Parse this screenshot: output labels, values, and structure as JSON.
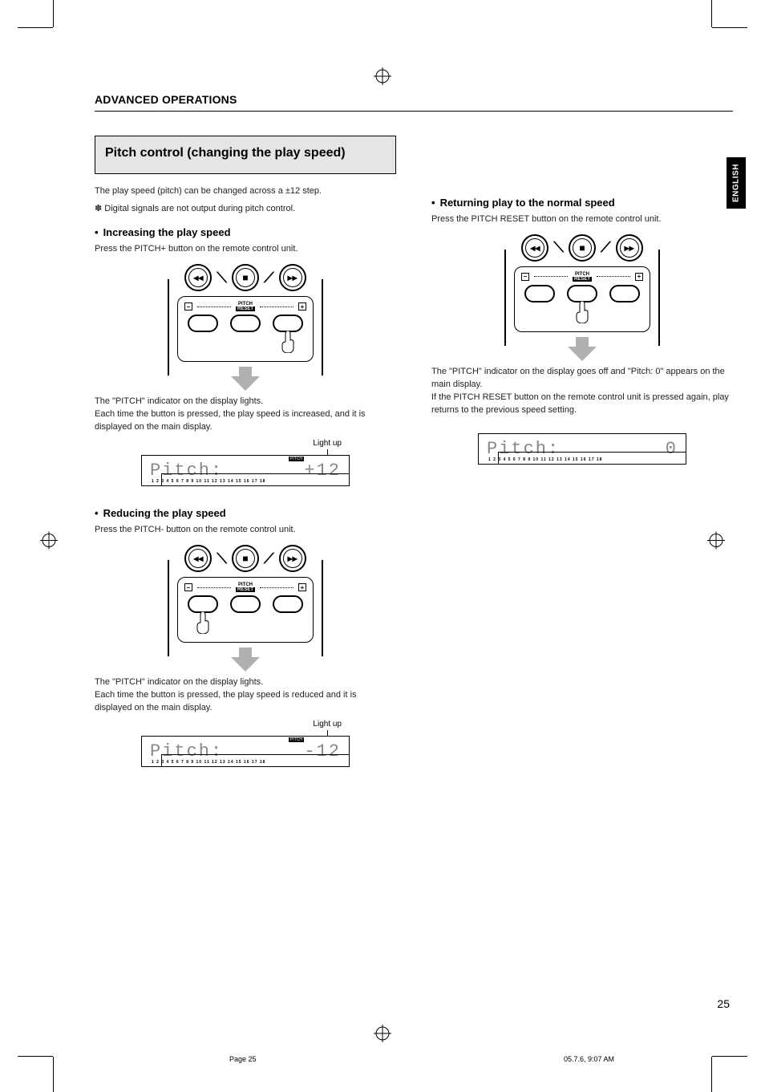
{
  "header": {
    "section": "ADVANCED OPERATIONS"
  },
  "language_tab": "ENGLISH",
  "feature": {
    "title": "Pitch control (changing the play speed)"
  },
  "intro": {
    "line1": "The play speed (pitch) can be changed across a ±12 step.",
    "note": "✽  Digital signals are not output during pitch control."
  },
  "increase": {
    "heading": "Increasing the play speed",
    "instruction": "Press the PITCH+ button on the remote control unit.",
    "result1": "The \"PITCH\" indicator on the display lights.",
    "result2": "Each time the button is pressed, the play speed is increased, and it is displayed on the main display.",
    "light_up": "Light up",
    "lcd_tag": "PITCH",
    "lcd_left": "Pitch:",
    "lcd_right": "+12",
    "ticks": "1 2   3 4   5 6   7 8   9 10  11 12  13 14  15 16  17 18"
  },
  "reduce": {
    "heading": "Reducing the play speed",
    "instruction": "Press the PITCH- button on the remote control unit.",
    "result1": "The \"PITCH\" indicator on the display lights.",
    "result2": "Each time the button is pressed, the play speed is reduced and it is displayed on the main display.",
    "light_up": "Light up",
    "lcd_tag": "PITCH",
    "lcd_left": "Pitch:",
    "lcd_right": "-12",
    "ticks": "1 2   3 4   5 6   7 8   9 10  11 12  13 14  15 16  17 18"
  },
  "reset": {
    "heading": "Returning play to the normal speed",
    "instruction": "Press the PITCH RESET button on the remote control unit.",
    "result1": "The \"PITCH\" indicator on the display goes off and \"Pitch: 0\" appears on the main display.",
    "result2": "If the PITCH RESET button on the remote control unit is pressed again, play returns to the previous speed setting.",
    "lcd_left": "Pitch:",
    "lcd_right": "0",
    "ticks": "1 2   3 4   5 6   7 8   9 10  11 12  13 14  15 16  17 18"
  },
  "remote_panel": {
    "minus_box": "–",
    "plus_box": "+",
    "pitch": "PITCH",
    "reset": "RESET"
  },
  "page_number": "25",
  "footer": {
    "left": "Page 25",
    "right": "05.7.6, 9:07 AM"
  }
}
